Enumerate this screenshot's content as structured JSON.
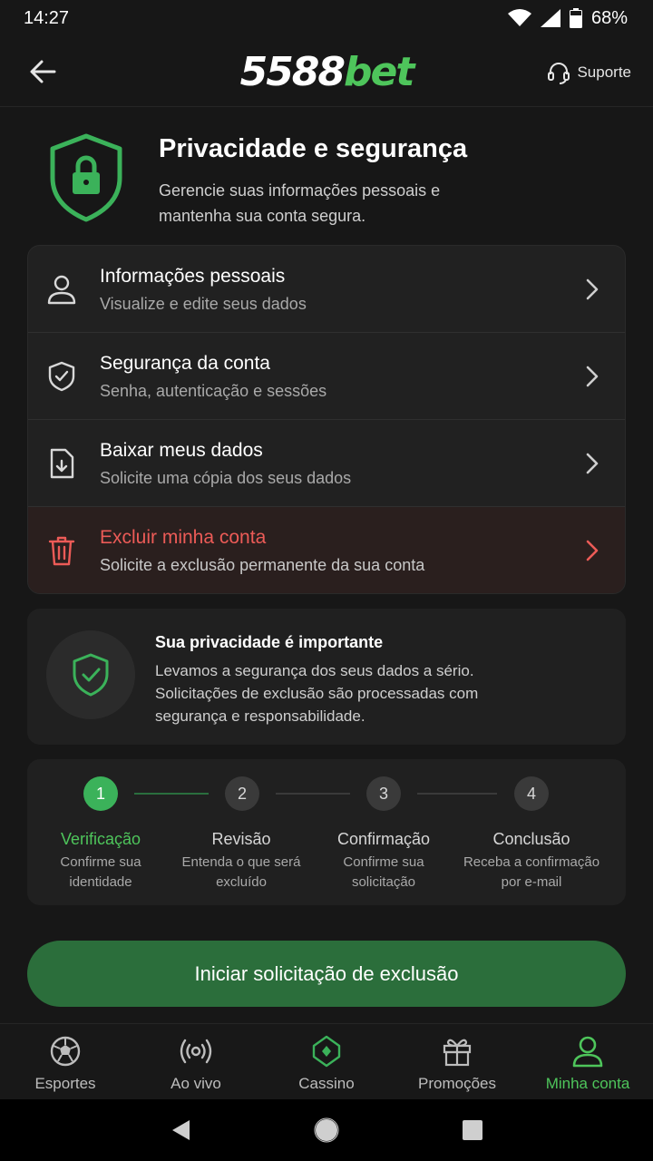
{
  "status": {
    "time": "14:27",
    "battery": "68%"
  },
  "header": {
    "logo_num": "5588",
    "logo_brand": "bet",
    "support_label": "Suporte"
  },
  "hero": {
    "title": "Privacidade e segurança",
    "subtitle": "Gerencie suas informações pessoais e mantenha sua conta segura."
  },
  "menu": [
    {
      "title": "Informações pessoais",
      "subtitle": "Visualize e edite seus dados",
      "icon": "user-icon"
    },
    {
      "title": "Segurança da conta",
      "subtitle": "Senha, autenticação e sessões",
      "icon": "shield-check-icon"
    },
    {
      "title": "Baixar meus dados",
      "subtitle": "Solicite uma cópia dos seus dados",
      "icon": "download-file-icon"
    },
    {
      "title": "Excluir minha conta",
      "subtitle": "Solicite a exclusão permanente da sua conta",
      "icon": "trash-icon"
    }
  ],
  "privacy": {
    "title": "Sua privacidade é importante",
    "text": "Levamos a segurança dos seus dados a sério. Solicitações de exclusão são processadas com segurança e responsabilidade."
  },
  "steps": [
    {
      "num": "1",
      "label": "Verificação",
      "desc": "Confirme sua identidade",
      "active": true
    },
    {
      "num": "2",
      "label": "Revisão",
      "desc": "Entenda o que será excluído",
      "active": false
    },
    {
      "num": "3",
      "label": "Confirmação",
      "desc": "Confirme sua solicitação",
      "active": false
    },
    {
      "num": "4",
      "label": "Conclusão",
      "desc": "Receba a confirmação por e-mail",
      "active": false
    }
  ],
  "cta_label": "Iniciar solicitação de exclusão",
  "nav": [
    {
      "label": "Esportes",
      "icon": "soccer-ball-icon"
    },
    {
      "label": "Ao vivo",
      "icon": "live-broadcast-icon"
    },
    {
      "label": "Cassino",
      "icon": "casino-chip-icon"
    },
    {
      "label": "Promoções",
      "icon": "gift-icon"
    },
    {
      "label": "Minha conta",
      "icon": "user-icon",
      "active": true
    }
  ],
  "colors": {
    "accent": "#4ec55b",
    "danger": "#ec5b57",
    "cta": "#2b6e3b"
  }
}
